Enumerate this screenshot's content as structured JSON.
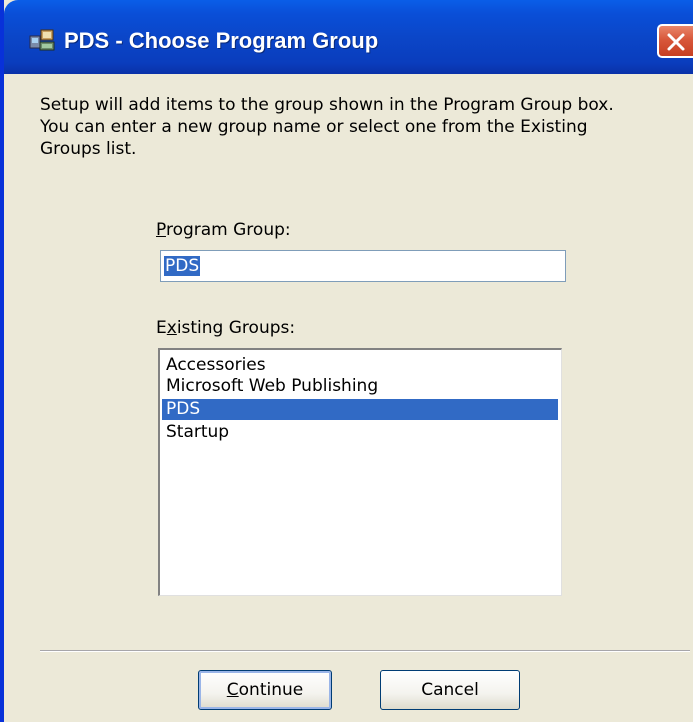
{
  "window": {
    "title": "PDS - Choose Program Group",
    "title_icon": "setup-icon",
    "close_icon": "close-icon"
  },
  "instructions": {
    "line1": "Setup will add items to the group shown in the Program Group box.",
    "line2": "You can enter a new group name or select one from the Existing",
    "line3": "Groups list."
  },
  "program_group": {
    "label_mnemonic": "P",
    "label_rest": "rogram Group:",
    "value": "PDS"
  },
  "existing_groups": {
    "label_first": "E",
    "label_mnemonic": "x",
    "label_rest": "isting Groups:",
    "items": [
      {
        "label": "Accessories"
      },
      {
        "label": "Microsoft Web Publishing"
      },
      {
        "label": "PDS"
      },
      {
        "label": "Startup"
      }
    ],
    "selected": "PDS"
  },
  "buttons": {
    "continue_mnemonic": "C",
    "continue_rest": "ontinue",
    "cancel": "Cancel"
  },
  "colors": {
    "titlebar": "#0a46c8",
    "selection": "#316ac5",
    "close": "#d8573a",
    "dialog_bg": "#ece9d8"
  }
}
